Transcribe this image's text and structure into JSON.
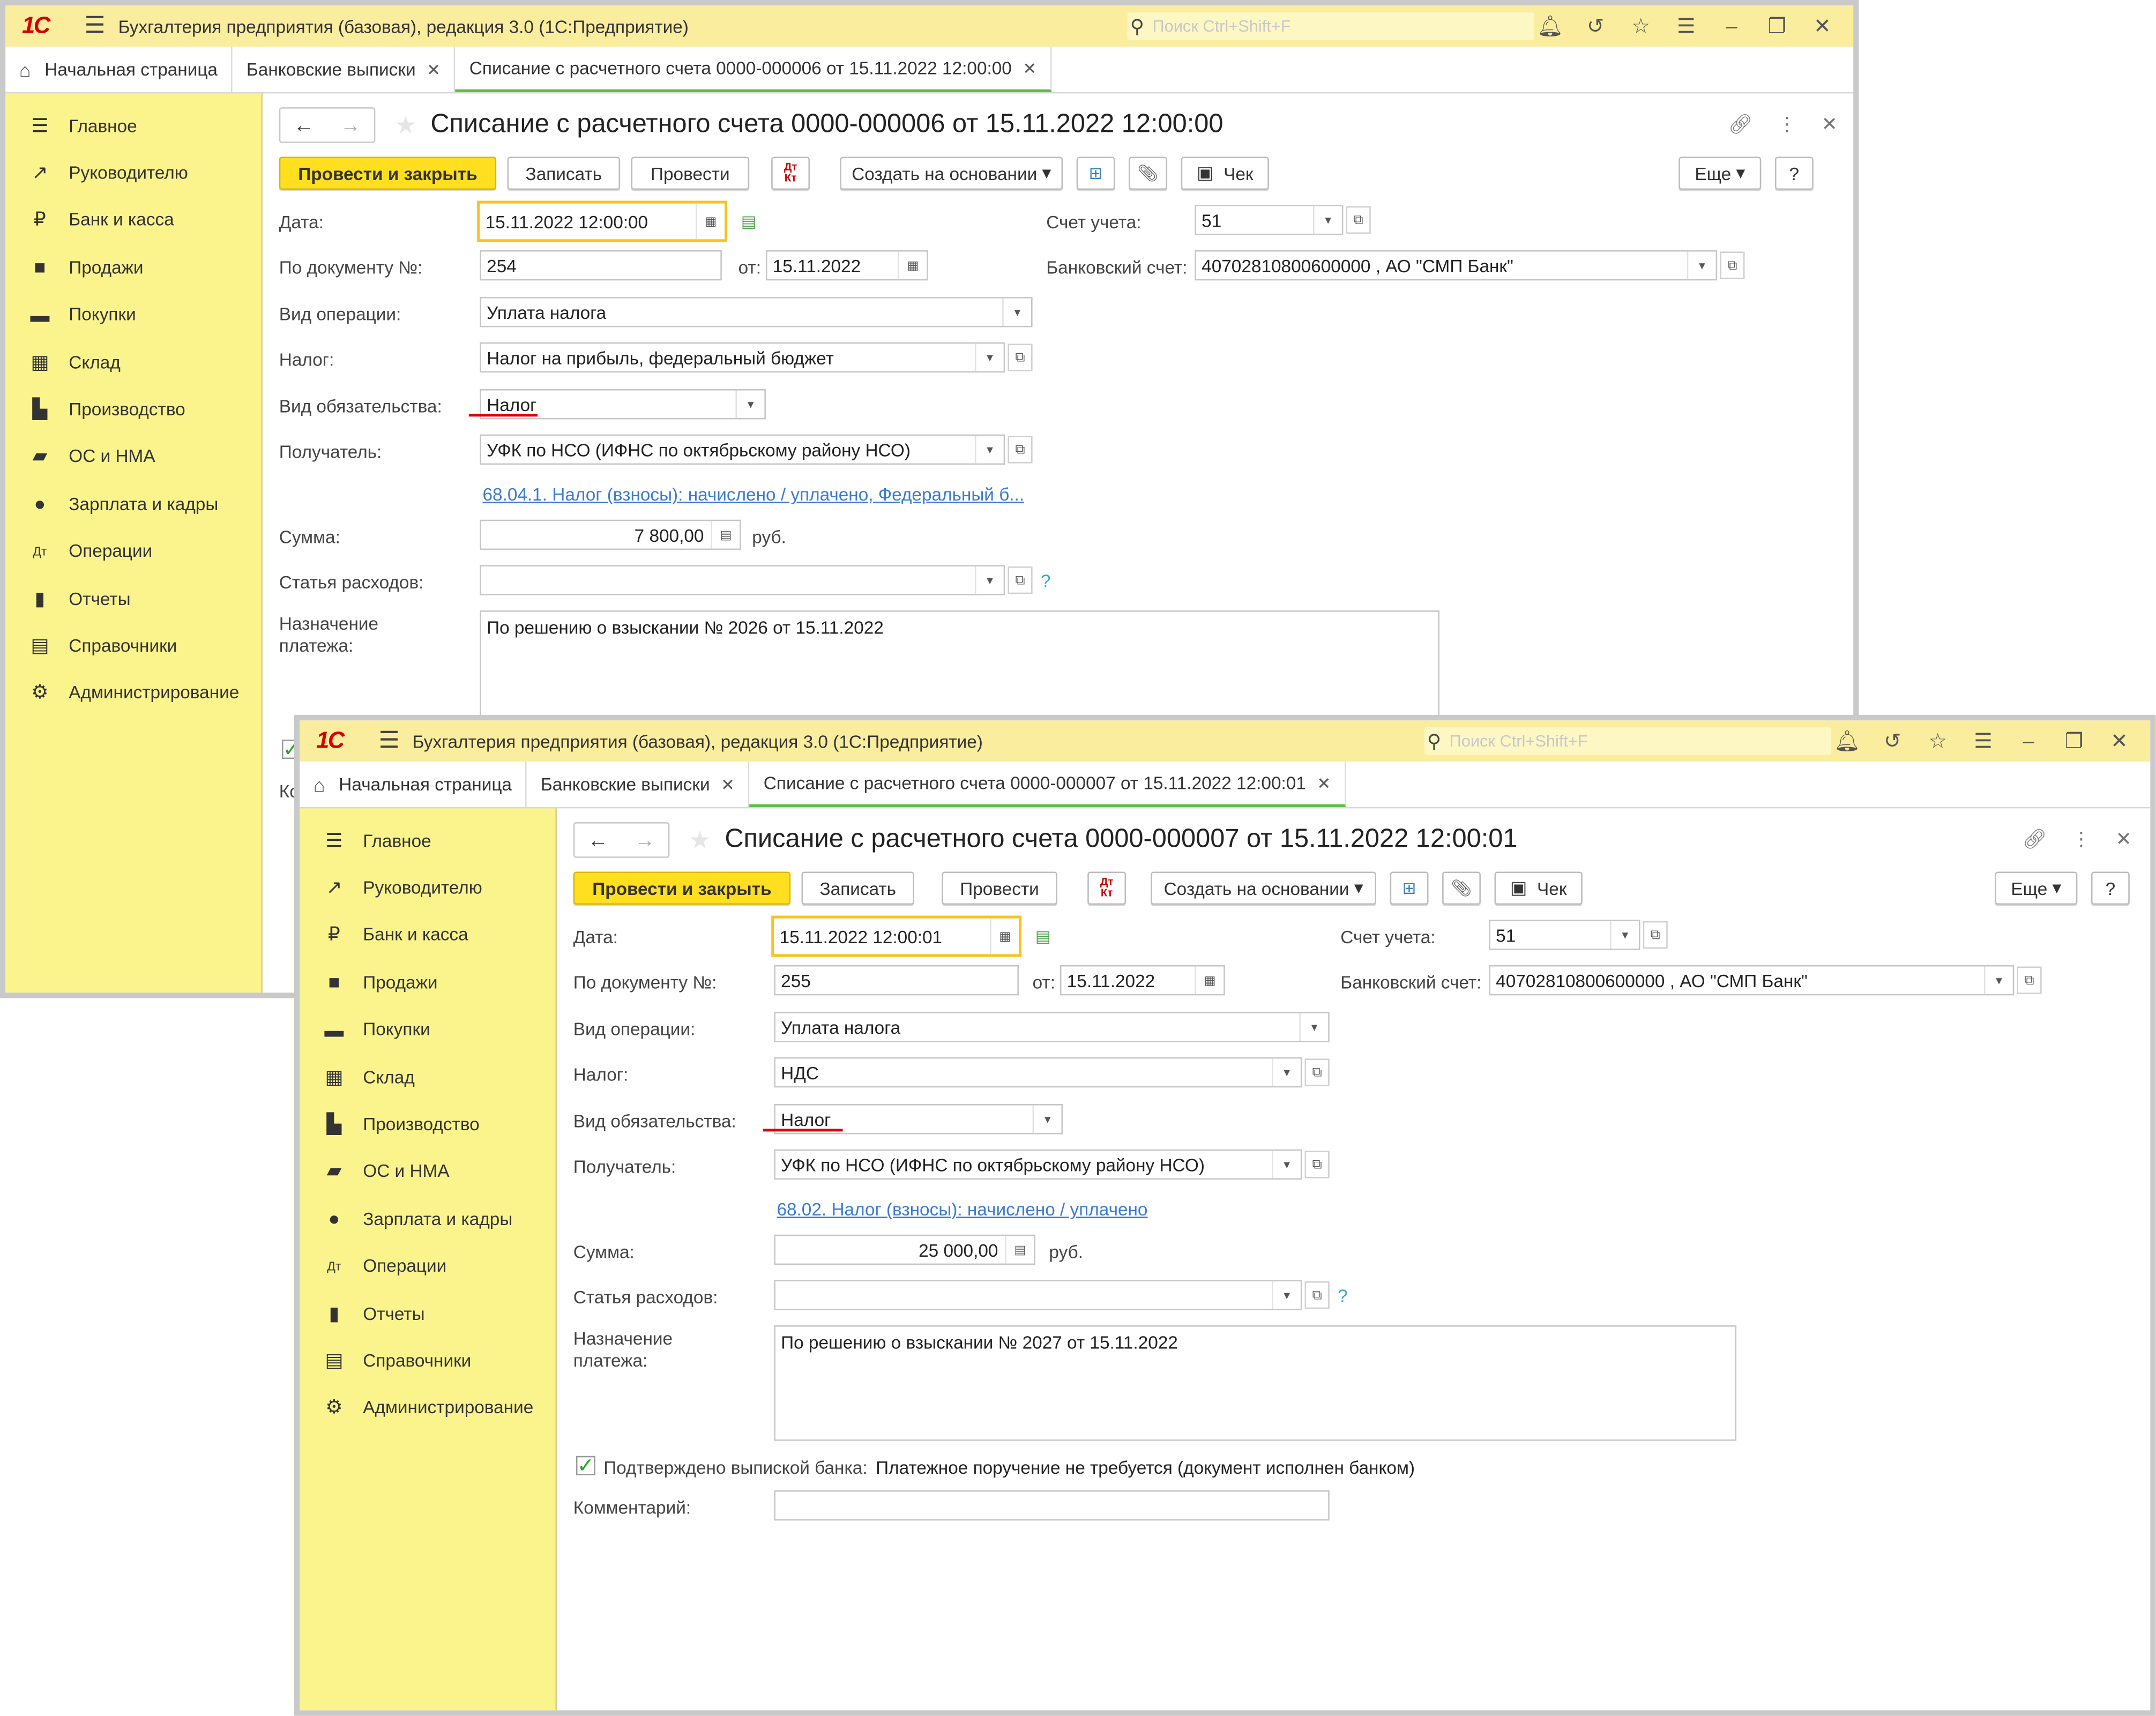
{
  "app": {
    "title": "Бухгалтерия предприятия (базовая), редакция 3.0  (1С:Предприятие)",
    "search_placeholder": "Поиск Ctrl+Shift+F",
    "logo": "1С"
  },
  "tabs": {
    "home": "Начальная страница",
    "bank": "Банковские выписки"
  },
  "sidebar": [
    "Главное",
    "Руководителю",
    "Банк и касса",
    "Продажи",
    "Покупки",
    "Склад",
    "Производство",
    "ОС и НМА",
    "Зарплата и кадры",
    "Операции",
    "Отчеты",
    "Справочники",
    "Администрирование"
  ],
  "toolbar": {
    "post_close": "Провести и закрыть",
    "save": "Записать",
    "post": "Провести",
    "create_based": "Создать на основании",
    "check": "Чек",
    "more": "Еще",
    "help": "?"
  },
  "labels": {
    "date": "Дата:",
    "doc_no": "По документу №:",
    "from": "от:",
    "operation": "Вид операции:",
    "tax": "Налог:",
    "obligation": "Вид обязательства:",
    "recipient": "Получатель:",
    "amount": "Сумма:",
    "currency": "руб.",
    "expense": "Статья расходов:",
    "purpose": "Назначение платежа:",
    "account": "Счет учета:",
    "bank_account": "Банковский счет:",
    "confirmed": "Подтверждено выпиской банка:",
    "comment": "Комментарий:",
    "comment_short": "Ко"
  },
  "doc1": {
    "tab": "Списание с расчетного счета 0000-000006 от 15.11.2022 12:00:00",
    "title": "Списание с расчетного счета 0000-000006 от 15.11.2022 12:00:00",
    "date": "15.11.2022 12:00:00",
    "doc_no": "254",
    "doc_date": "15.11.2022",
    "operation": "Уплата налога",
    "tax": "Налог на прибыль, федеральный бюджет",
    "obligation": "Налог",
    "recipient": "УФК по НСО (ИФНС по октябрьскому району НСО)",
    "account_link": "68.04.1. Налог (взносы): начислено / уплачено, Федеральный б...",
    "amount": "7 800,00",
    "expense": "",
    "purpose": "По решению о взыскании № 2026 от 15.11.2022",
    "account": "51",
    "bank_account": "40702810800600000      , АО \"СМП Банк\""
  },
  "doc2": {
    "tab": "Списание с расчетного счета 0000-000007 от 15.11.2022 12:00:01",
    "title": "Списание с расчетного счета 0000-000007 от 15.11.2022 12:00:01",
    "date": "15.11.2022 12:00:01",
    "doc_no": "255",
    "doc_date": "15.11.2022",
    "operation": "Уплата налога",
    "tax": "НДС",
    "obligation": "Налог",
    "recipient": "УФК по НСО (ИФНС по октябрьскому району НСО)",
    "account_link": "68.02. Налог (взносы): начислено / уплачено",
    "amount": "25 000,00",
    "expense": "",
    "purpose": "По решению о взыскании № 2027 от 15.11.2022",
    "account": "51",
    "bank_account": "40702810800600000      , АО \"СМП Банк\"",
    "confirmed_text": "Платежное поручение не требуется (документ исполнен банком)",
    "comment": ""
  },
  "colors": {
    "sidebar": "#fbf48d",
    "titlebar": "#fbed9e",
    "primary_button": "#ffdf1f",
    "link": "#3a7bd0",
    "accent_green": "#5bbf3d"
  }
}
